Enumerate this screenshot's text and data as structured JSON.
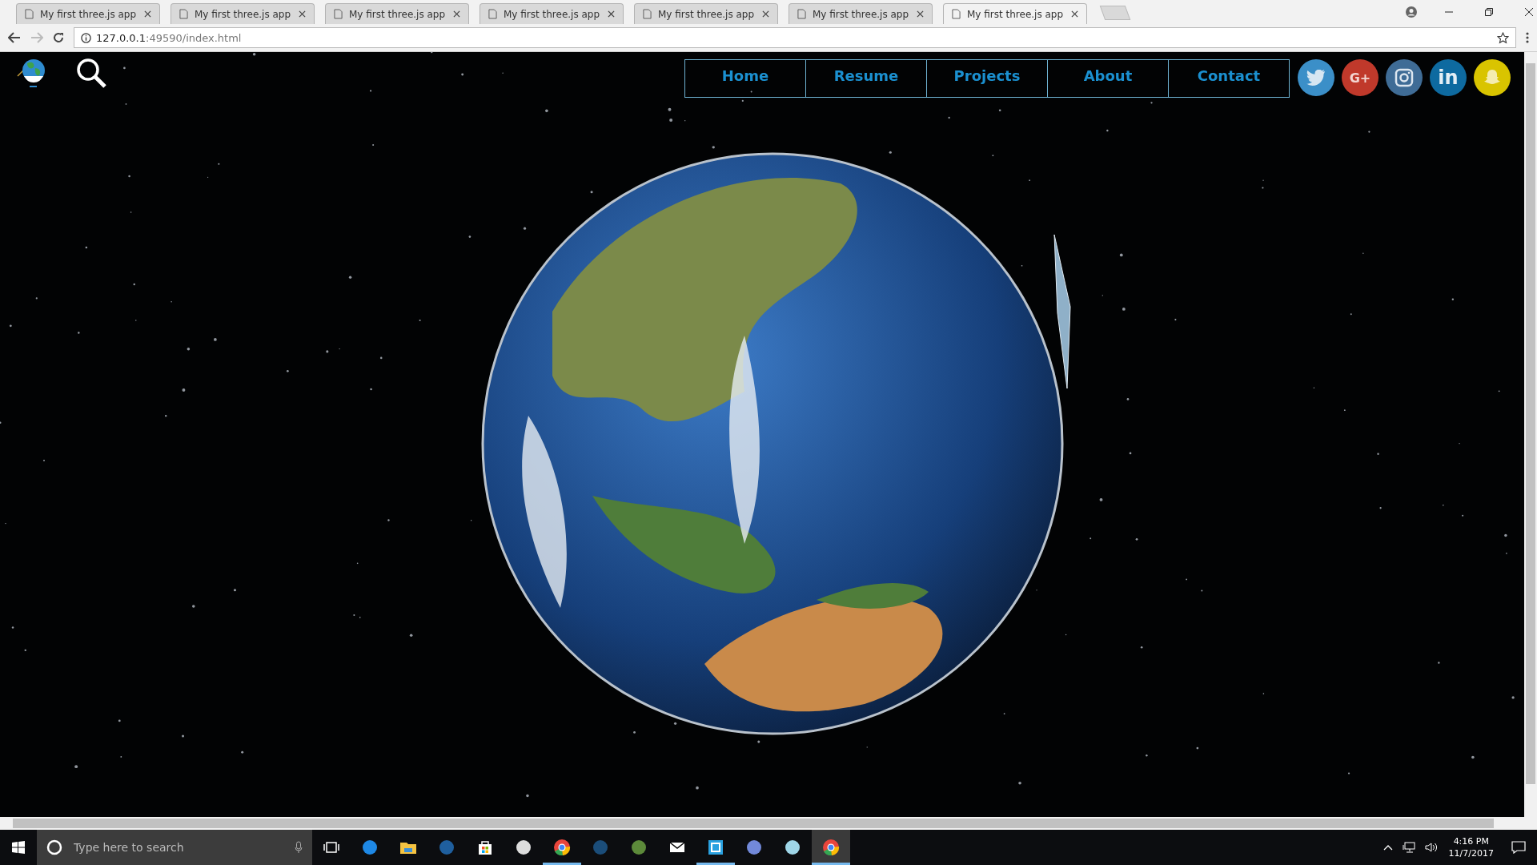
{
  "browser": {
    "tabs": [
      {
        "title": "My first three.js app",
        "selected": false
      },
      {
        "title": "My first three.js app",
        "selected": false
      },
      {
        "title": "My first three.js app",
        "selected": false
      },
      {
        "title": "My first three.js app",
        "selected": false
      },
      {
        "title": "My first three.js app",
        "selected": false
      },
      {
        "title": "My first three.js app",
        "selected": false
      },
      {
        "title": "My first three.js app",
        "selected": true
      }
    ],
    "url_host": "127.0.0.1",
    "url_path": ":49590/index.html"
  },
  "nav": {
    "links": [
      {
        "label": "Home"
      },
      {
        "label": "Resume"
      },
      {
        "label": "Projects"
      },
      {
        "label": "About"
      },
      {
        "label": "Contact"
      }
    ],
    "social": [
      {
        "kind": "twitter",
        "color": "#3b8fc8"
      },
      {
        "kind": "googleplus",
        "color": "#c0392b",
        "label": "G+"
      },
      {
        "kind": "instagram",
        "color": "#3f6c96"
      },
      {
        "kind": "linkedin",
        "color": "#0e6aa0",
        "label": "in"
      },
      {
        "kind": "snapchat",
        "color": "#d9c400"
      }
    ]
  },
  "taskbar": {
    "search_placeholder": "Type here to search",
    "apps": [
      {
        "kind": "taskview",
        "running": false,
        "selected": false
      },
      {
        "kind": "edge",
        "running": false,
        "selected": false
      },
      {
        "kind": "folder",
        "running": false,
        "selected": false
      },
      {
        "kind": "blizzard",
        "running": false,
        "selected": false
      },
      {
        "kind": "store",
        "running": false,
        "selected": false
      },
      {
        "kind": "headset",
        "running": false,
        "selected": false
      },
      {
        "kind": "chrome",
        "running": true,
        "selected": false
      },
      {
        "kind": "steam",
        "running": false,
        "selected": false
      },
      {
        "kind": "cube",
        "running": false,
        "selected": false
      },
      {
        "kind": "mail",
        "running": false,
        "selected": false
      },
      {
        "kind": "square",
        "running": true,
        "selected": false
      },
      {
        "kind": "discord",
        "running": false,
        "selected": false
      },
      {
        "kind": "notepad",
        "running": false,
        "selected": false
      },
      {
        "kind": "chrome",
        "running": true,
        "selected": true
      }
    ],
    "time": "4:16 PM",
    "date": "11/7/2017"
  }
}
